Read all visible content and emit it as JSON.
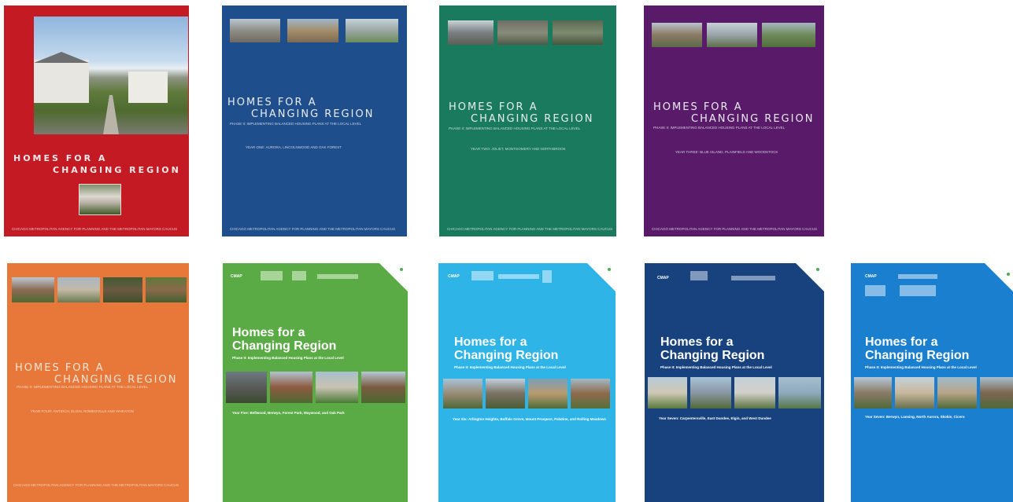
{
  "covers": [
    {
      "title_line1": "HOMES FOR A",
      "title_line2": "CHANGING REGION",
      "footer": "CHICAGO METROPOLITAN AGENCY FOR PLANNING AND THE METROPOLITAN MAYORS CAUCUS",
      "bg": "#c41a24"
    },
    {
      "title_line1": "HOMES FOR A",
      "title_line2": "CHANGING REGION",
      "subtitle": "PHASE II: IMPLEMENTING BALANCED HOUSING PLANS AT THE LOCAL LEVEL",
      "year": "YEAR ONE: AURORA, LINCOLNWOOD AND OAK FOREST",
      "footer": "CHICAGO METROPOLITAN AGENCY FOR PLANNING AND THE METROPOLITAN MAYORS CAUCUS",
      "bg": "#1f4e8c"
    },
    {
      "title_line1": "HOMES FOR A",
      "title_line2": "CHANGING REGION",
      "subtitle": "PHASE II: IMPLEMENTING BALANCED HOUSING PLANS AT THE LOCAL LEVEL",
      "year": "YEAR TWO: JOLIET, MONTGOMERY AND NORTHBROOK",
      "footer": "CHICAGO METROPOLITAN AGENCY FOR PLANNING AND THE METROPOLITAN MAYORS CAUCUS",
      "bg": "#1a7a5e"
    },
    {
      "title_line1": "HOMES FOR A",
      "title_line2": "CHANGING REGION",
      "subtitle": "PHASE II: IMPLEMENTING BALANCED HOUSING PLANS AT THE LOCAL LEVEL",
      "year": "YEAR THREE: BLUE ISLAND, PLAINFIELD AND WOODSTOCK",
      "footer": "CHICAGO METROPOLITAN AGENCY FOR PLANNING AND THE METROPOLITAN MAYORS CAUCUS",
      "bg": "#5a1a6a"
    },
    {
      "title_line1": "HOMES FOR A",
      "title_line2": "CHANGING REGION",
      "subtitle": "PHASE II: IMPLEMENTING BALANCED HOUSING PLANS AT THE LOCAL LEVEL",
      "year": "YEAR FOUR: ANTIOCH, ELGIN, ROMEOVILLE AND WHEATON",
      "footer": "CHICAGO METROPOLITAN AGENCY FOR PLANNING AND THE METROPOLITAN MAYORS CAUCUS",
      "bg": "#e8783a"
    },
    {
      "logo": "CMAP",
      "title_line1": "Homes for a",
      "title_line2": "Changing Region",
      "subtitle": "Phase II: Implementing Balanced Housing Plans at the Local Level",
      "year": "Year Five: Bellwood, Berwyn, Forest Park, Maywood, and Oak Park",
      "bg": "#5aab45"
    },
    {
      "logo": "CMAP",
      "title_line1": "Homes for a",
      "title_line2": "Changing Region",
      "subtitle": "Phase II: Implementing Balanced Housing Plans at the Local Level",
      "year": "Year Six: Arlington Heights, Buffalo Grove, Mount Prospect, Palatine, and Rolling Meadows",
      "bg": "#2fb4e8"
    },
    {
      "logo": "CMAP",
      "title_line1": "Homes for a",
      "title_line2": "Changing Region",
      "subtitle": "Phase II: Implementing Balanced Housing Plans at the Local Level",
      "year": "Year Seven: Carpentersville, East Dundee, Elgin, and West Dundee",
      "bg": "#17427e"
    },
    {
      "logo": "CMAP",
      "title_line1": "Homes for a",
      "title_line2": "Changing Region",
      "subtitle": "Phase II: Implementing Balanced Housing Plans at the Local Level",
      "year": "Year Seven: Berwyn, Lansing, North Aurora, Skokie, Cicero",
      "bg": "#1a7fcf"
    }
  ]
}
